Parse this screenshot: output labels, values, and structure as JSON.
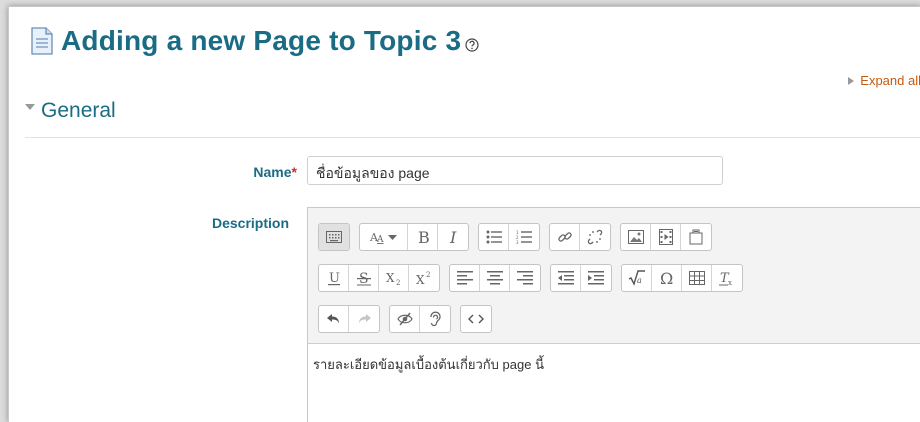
{
  "page": {
    "title": "Adding a new Page to Topic 3",
    "expand_all": "Expand all",
    "section": "General"
  },
  "form": {
    "name_label": "Name",
    "required_mark": "*",
    "name_value": "ชื่อข้อมูลของ page",
    "description_label": "Description",
    "description_content": "รายละเอียดข้อมูลเบื้องต้นเกี่ยวกับ page นี้"
  },
  "toolbar": {
    "row1": [
      [
        "toolbar-toggle"
      ],
      [
        "text-style"
      ],
      [
        "bold",
        "italic"
      ],
      [
        "unordered-list",
        "ordered-list"
      ],
      [
        "link",
        "unlink"
      ],
      [
        "image",
        "media",
        "manage-files"
      ]
    ],
    "row2": [
      [
        "underline",
        "strikethrough",
        "subscript",
        "superscript"
      ],
      [
        "align-left",
        "align-center",
        "align-right"
      ],
      [
        "outdent",
        "indent"
      ],
      [
        "equation",
        "special-character",
        "table",
        "clear-formatting"
      ]
    ],
    "row3": [
      [
        "undo",
        "redo"
      ],
      [
        "accessibility-checker",
        "screenreader-helper"
      ],
      [
        "html-source"
      ]
    ]
  },
  "colors": {
    "heading": "#1a6c84",
    "link": "#c55a11",
    "required": "#c9302c"
  }
}
